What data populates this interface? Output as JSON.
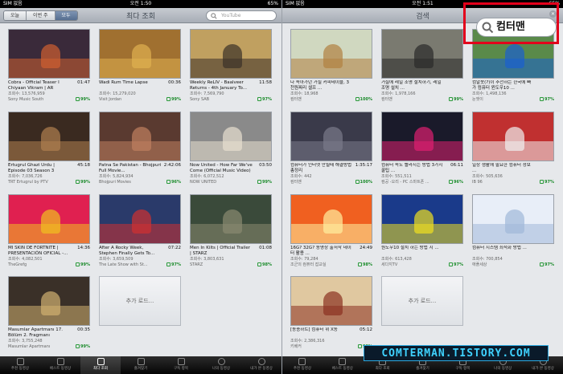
{
  "left": {
    "status": {
      "carrier": "SIM 없음",
      "time": "오전 1:50",
      "battery": "65%"
    },
    "segments": [
      "오늘",
      "이번 주",
      "모두"
    ],
    "active_segment": 2,
    "title": "최다 조회",
    "search_placeholder": "YouTube",
    "videos": [
      {
        "title": "Cobra - Official Teaser I Chiyaan Vikram | AR Rahm...",
        "duration": "01:47",
        "views": "조회수: 13,576,959",
        "channel": "Sony Music South",
        "rating": "99%",
        "color": "#3a2a3a",
        "accent": "#d06030"
      },
      {
        "title": "Wadi Rum Time Lapse",
        "duration": "00:36",
        "views": "조회수: 15,279,020",
        "channel": "Visit Jordan",
        "rating": "99%",
        "color": "#a07030",
        "accent": "#e0b050"
      },
      {
        "title": "Weekly ReLIV - Baalveer Returns - 4th January To...",
        "duration": "11:58",
        "views": "조회수: 7,569,790",
        "channel": "Sony SAB",
        "rating": "97%",
        "color": "#c0a060",
        "accent": "#3a3028"
      },
      {
        "title": "Ertugrul Ghazi Urdu | Episode 03 Season 3",
        "duration": "45:18",
        "views": "조회수: 7,036,726",
        "channel": "TRT Ertugrul by PTV",
        "rating": "99%",
        "color": "#3a2a20",
        "accent": "#b08050"
      },
      {
        "title": "Patna Se Pakistan - Bhojpuri Full Movie...",
        "duration": "2:42:06",
        "views": "조회수: 5,824,934",
        "channel": "Bhojpuri Movies",
        "rating": "96%",
        "color": "#5a3a30",
        "accent": "#c08060"
      },
      {
        "title": "Now United - How Far We've Come (Official Music Video)",
        "duration": "03:50",
        "views": "조회수: 6,072,512",
        "channel": "NOW UNITED",
        "rating": "99%",
        "color": "#8a8a8a",
        "accent": "#e8e0d0"
      },
      {
        "title": "MI SKIN DE FORTNITE | PRESENTACIÓN OFICIAL -...",
        "duration": "14:36",
        "views": "조회수: 4,082,501",
        "channel": "TheGrefg",
        "rating": "99%",
        "color": "#e02050",
        "accent": "#f0c020"
      },
      {
        "title": "After A Rocky Week, Stephen Finally Gets To...",
        "duration": "07:22",
        "views": "조회수: 3,659,509",
        "channel": "The Late Show with St...",
        "rating": "97%",
        "color": "#2a3a6a",
        "accent": "#d03030"
      },
      {
        "title": "Men In Kilts | Official Trailer | STARZ",
        "duration": "01:08",
        "views": "조회수: 3,803,631",
        "channel": "STARZ",
        "rating": "98%",
        "color": "#3a4a3a",
        "accent": "#8a8a70"
      },
      {
        "title": "Masumlar Apartmanı 17. Bölüm 2. Fragmanı",
        "duration": "00:35",
        "views": "조회수: 3,755,248",
        "channel": "Masumlar Apartmanı",
        "rating": "99%",
        "color": "#3a3028",
        "accent": "#d0b070"
      }
    ],
    "more_label": "추가 로드...",
    "tabs": [
      "추천 동영상",
      "베스트 동영상",
      "최다 조회",
      "즐겨찾기",
      "구독 항목",
      "나의 동영상",
      "내가 본 동영상"
    ],
    "active_tab": 2
  },
  "right": {
    "status": {
      "carrier": "SIM 없음",
      "time": "오전 1:51",
      "battery": "65%"
    },
    "title": "검색",
    "search_query": "컴터맨",
    "videos": [
      {
        "title": "다 속아가던 거실 커피테이블, 3천원짜리 셀프 ...",
        "duration": "",
        "views": "조회수: 18,968",
        "channel": "컴터맨",
        "rating": "100%",
        "color": "#d0d8c0",
        "accent": "#b08040"
      },
      {
        "title": "거실에 레일 조명 설치하기, 레일 조명 설치 ...",
        "duration": "",
        "views": "조회수: 1,978,166",
        "channel": "컴터맨",
        "rating": "99%",
        "color": "#7a7a70",
        "accent": "#2a2a2a"
      },
      {
        "title": "컴알못(?)이 추천하는 한국에 빠가 컴퓨터 윈도우10 ...",
        "duration": "",
        "views": "조회수: 1,498,136",
        "channel": "눈엣이",
        "rating": "97%",
        "color": "#5a8a4a",
        "accent": "#1a60d0"
      },
      {
        "title": "컴퓨터가 인터넷 안될때 해결방법 총정리",
        "duration": "1:35:17",
        "views": "조회수: 442",
        "channel": "컴터맨",
        "rating": "100%",
        "color": "#3a3a4a",
        "accent": "#7a7a8a"
      },
      {
        "title": "컴퓨터 속도 빨라지는 방법 3가지 꿀팁 ...",
        "duration": "06:11",
        "views": "조회수: 551,511",
        "channel": "컴공 -오리 - PC 스마트폰 ...",
        "rating": "96%",
        "color": "#1a1a2a",
        "accent": "#e02070"
      },
      {
        "title": "일상 생활에 필요한 컴퓨터 정보 ...",
        "duration": "",
        "views": "조회수: 505,636",
        "channel": "IB 96",
        "rating": "97%",
        "color": "#c03030",
        "accent": "#f0f0f0"
      },
      {
        "title": "16G? 32G? 동영상 출저작 데이터 활용 ...",
        "duration": "24:49",
        "views": "조회수: 79,284",
        "channel": "조군의 컴퓨터 잡교실",
        "rating": "98%",
        "color": "#f06020",
        "accent": "#fff0a0"
      },
      {
        "title": "원도우10 설치 하는 방법 지 ...",
        "duration": "",
        "views": "조회수: 613,428",
        "channel": "세다지TV",
        "rating": "97%",
        "color": "#1a3a8a",
        "accent": "#f0e020"
      },
      {
        "title": "컴퓨터 시스템 최적화 방법 ...",
        "duration": "",
        "views": "조회수: 700,854",
        "channel": "애플세상",
        "rating": "97%",
        "color": "#e8eef8",
        "accent": "#a0b8d8"
      },
      {
        "title": "[동종하트] 컴퓨터 위 X동",
        "duration": "05:12",
        "views": "조회수: 2,386,316",
        "channel": "키베커",
        "rating": "98%",
        "color": "#e0c8a0",
        "accent": "#8a3020"
      }
    ],
    "more_label": "추가 로드...",
    "tabs": [
      "추천 동영상",
      "베스트 동영상",
      "최다 조회",
      "즐겨찾기",
      "구독 항목",
      "나의 동영상",
      "내가 본 동영상"
    ],
    "active_tab": -1
  },
  "watermark": "COMTERMAN.TISTORY.COM",
  "colors": {
    "highlight_box": "#e3001b",
    "rating_green": "#1a8a2a",
    "active_segment": "#566e90"
  }
}
